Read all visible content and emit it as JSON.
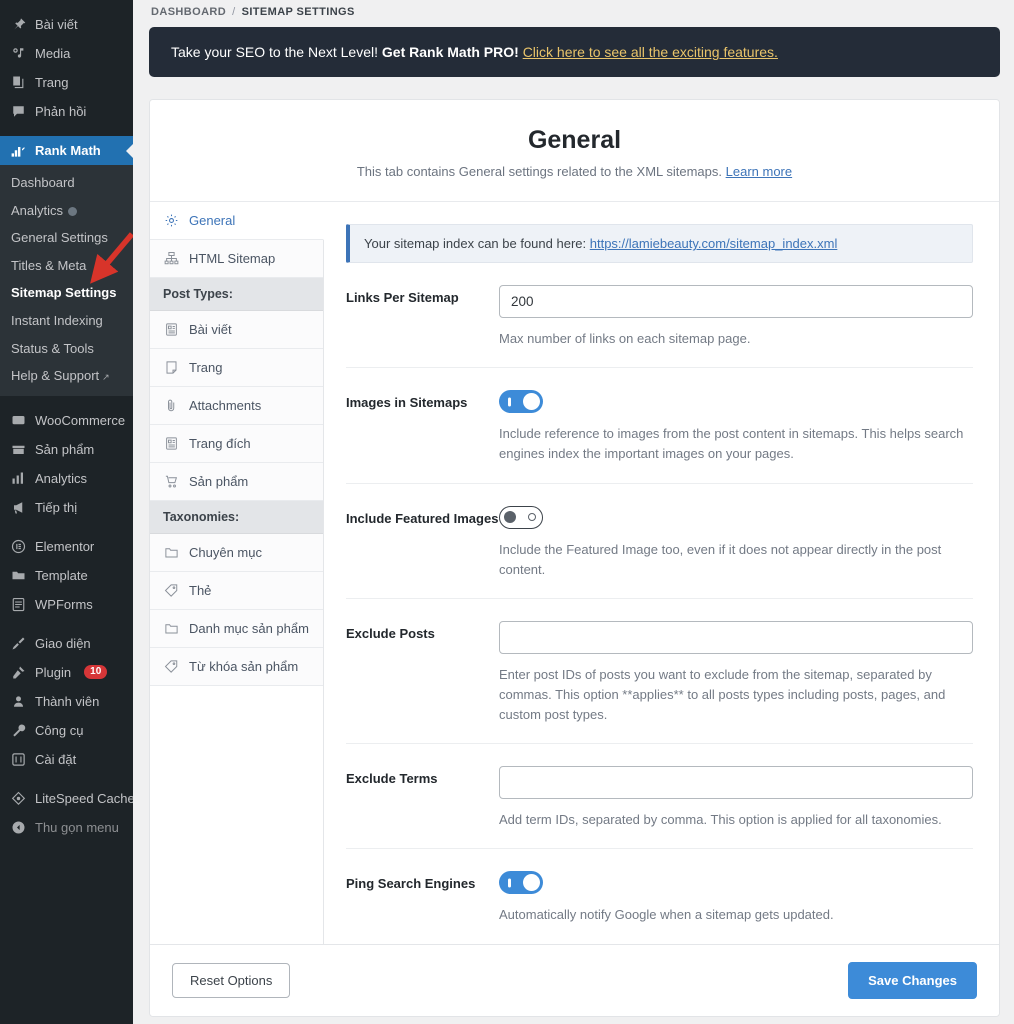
{
  "sidebar": {
    "top_items": [
      {
        "label": "Bài viết",
        "icon": "pin-icon"
      },
      {
        "label": "Media",
        "icon": "media-icon"
      },
      {
        "label": "Trang",
        "icon": "pages-icon"
      },
      {
        "label": "Phản hồi",
        "icon": "comment-icon"
      }
    ],
    "active_item": {
      "label": "Rank Math",
      "icon": "rank-math-icon"
    },
    "submenu": [
      {
        "label": "Dashboard",
        "current": false
      },
      {
        "label": "Analytics",
        "current": false,
        "dot": true
      },
      {
        "label": "General Settings",
        "current": false
      },
      {
        "label": "Titles & Meta",
        "current": false
      },
      {
        "label": "Sitemap Settings",
        "current": true
      },
      {
        "label": "Instant Indexing",
        "current": false
      },
      {
        "label": "Status & Tools",
        "current": false
      },
      {
        "label": "Help & Support",
        "current": false,
        "external": true
      }
    ],
    "group_two": [
      {
        "label": "WooCommerce",
        "icon": "woo-icon"
      },
      {
        "label": "Sản phẩm",
        "icon": "product-icon"
      },
      {
        "label": "Analytics",
        "icon": "chart-icon"
      },
      {
        "label": "Tiếp thị",
        "icon": "megaphone-icon"
      }
    ],
    "group_three": [
      {
        "label": "Elementor",
        "icon": "elementor-icon"
      },
      {
        "label": "Template",
        "icon": "folder-icon"
      },
      {
        "label": "WPForms",
        "icon": "forms-icon"
      }
    ],
    "group_four": [
      {
        "label": "Giao diện",
        "icon": "appearance-icon"
      },
      {
        "label": "Plugin",
        "icon": "plugin-icon",
        "badge": "10"
      },
      {
        "label": "Thành viên",
        "icon": "users-icon"
      },
      {
        "label": "Công cụ",
        "icon": "tools-icon"
      },
      {
        "label": "Cài đặt",
        "icon": "settings-icon"
      }
    ],
    "group_five": [
      {
        "label": "LiteSpeed Cache",
        "icon": "litespeed-icon"
      },
      {
        "label": "Thu gọn menu",
        "icon": "collapse-icon",
        "muted": true
      }
    ]
  },
  "breadcrumb": {
    "root": "DASHBOARD",
    "separator": "/",
    "current": "SITEMAP SETTINGS"
  },
  "pro_banner": {
    "text_before": "Take your SEO to the Next Level!",
    "text_bold": "Get Rank Math PRO!",
    "link": "Click here to see all the exciting features."
  },
  "page": {
    "title": "General",
    "subtitle": "This tab contains General settings related to the XML sitemaps.",
    "subtitle_link": "Learn more"
  },
  "tabs": [
    {
      "label": "General",
      "icon": "gear-icon",
      "active": true,
      "type": "tab"
    },
    {
      "label": "HTML Sitemap",
      "icon": "sitemap-icon",
      "active": false,
      "type": "tab"
    },
    {
      "label": "Post Types:",
      "type": "group"
    },
    {
      "label": "Bài viết",
      "icon": "post-icon",
      "active": false,
      "type": "tab"
    },
    {
      "label": "Trang",
      "icon": "page-icon",
      "active": false,
      "type": "tab"
    },
    {
      "label": "Attachments",
      "icon": "attachment-icon",
      "active": false,
      "type": "tab"
    },
    {
      "label": "Trang đích",
      "icon": "post-icon",
      "active": false,
      "type": "tab"
    },
    {
      "label": "Sản phẩm",
      "icon": "cart-icon",
      "active": false,
      "type": "tab"
    },
    {
      "label": "Taxonomies:",
      "type": "group"
    },
    {
      "label": "Chuyên mục",
      "icon": "folder-icon",
      "active": false,
      "type": "tab"
    },
    {
      "label": "Thẻ",
      "icon": "tag-icon",
      "active": false,
      "type": "tab"
    },
    {
      "label": "Danh mục sản phẩm",
      "icon": "folder-icon",
      "active": false,
      "type": "tab"
    },
    {
      "label": "Từ khóa sản phẩm",
      "icon": "tag-icon",
      "active": false,
      "type": "tab"
    }
  ],
  "notice": {
    "text": "Your sitemap index can be found here:",
    "url": "https://lamiebeauty.com/sitemap_index.xml"
  },
  "fields": {
    "links_per_sitemap": {
      "label": "Links Per Sitemap",
      "value": "200",
      "desc": "Max number of links on each sitemap page."
    },
    "images_in_sitemaps": {
      "label": "Images in Sitemaps",
      "state": "on",
      "desc": "Include reference to images from the post content in sitemaps. This helps search engines index the important images on your pages."
    },
    "include_featured_images": {
      "label": "Include Featured Images",
      "state": "off",
      "desc": "Include the Featured Image too, even if it does not appear directly in the post content."
    },
    "exclude_posts": {
      "label": "Exclude Posts",
      "value": "",
      "desc": "Enter post IDs of posts you want to exclude from the sitemap, separated by commas. This option **applies** to all posts types including posts, pages, and custom post types."
    },
    "exclude_terms": {
      "label": "Exclude Terms",
      "value": "",
      "desc": "Add term IDs, separated by comma. This option is applied for all taxonomies."
    },
    "ping_search_engines": {
      "label": "Ping Search Engines",
      "state": "on",
      "desc": "Automatically notify Google when a sitemap gets updated."
    }
  },
  "footer": {
    "reset_label": "Reset Options",
    "save_label": "Save Changes"
  },
  "colors": {
    "accent_blue": "#3d8bd8",
    "sidebar_bg": "#1d2327",
    "active_menu": "#2271b1",
    "banner_bg": "#242c38",
    "banner_link": "#e9c46a",
    "badge_red": "#d63638",
    "annotation_red": "#d8342a"
  }
}
